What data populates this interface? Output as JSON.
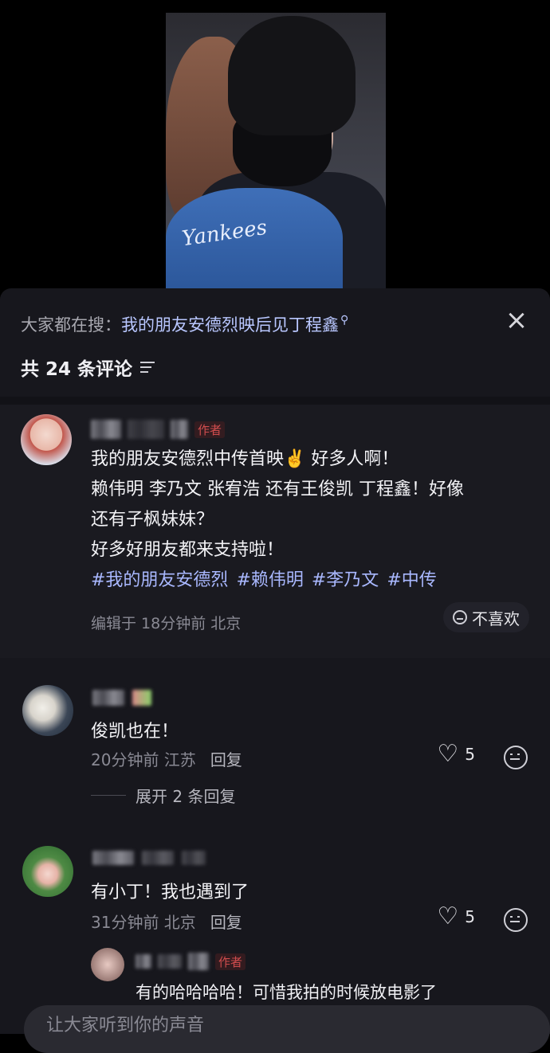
{
  "search": {
    "prefix": "大家都在搜：",
    "query": "我的朋友安德烈映后见丁程鑫",
    "close": "×"
  },
  "comments_header": {
    "count_text": "共 24 条评论"
  },
  "post": {
    "author_badge": "作者",
    "lines": [
      "我的朋友安德烈中传首映✌️ 好多人啊！",
      "赖伟明 李乃文 张宥浩 还有王俊凯 丁程鑫！好像",
      "还有子枫妹妹？",
      "好多好朋友都来支持啦！"
    ],
    "hashtags": [
      "#我的朋友安德烈",
      "#赖伟明",
      "#李乃文",
      "#中传"
    ],
    "meta": "编辑于  18分钟前 北京",
    "dislike_label": "不喜欢"
  },
  "comments": [
    {
      "text": "俊凯也在！",
      "time_loc": "20分钟前 江苏",
      "reply_label": "回复",
      "likes": "5",
      "expand": "展开 2 条回复"
    },
    {
      "text": "有小丁！我也遇到了",
      "time_loc": "31分钟前 北京",
      "reply_label": "回复",
      "likes": "5"
    }
  ],
  "sub_reply": {
    "badge": "作者",
    "text": "有的哈哈哈哈！可惜我拍的时候放电影了"
  },
  "input": {
    "placeholder": "让大家听到你的声音"
  },
  "video": {
    "cap_text": "Yankees"
  },
  "icons": {
    "close": "close-icon",
    "sort": "sort-icon",
    "search": "search-icon",
    "heart": "heart-icon",
    "emoji": "emoji-icon"
  }
}
